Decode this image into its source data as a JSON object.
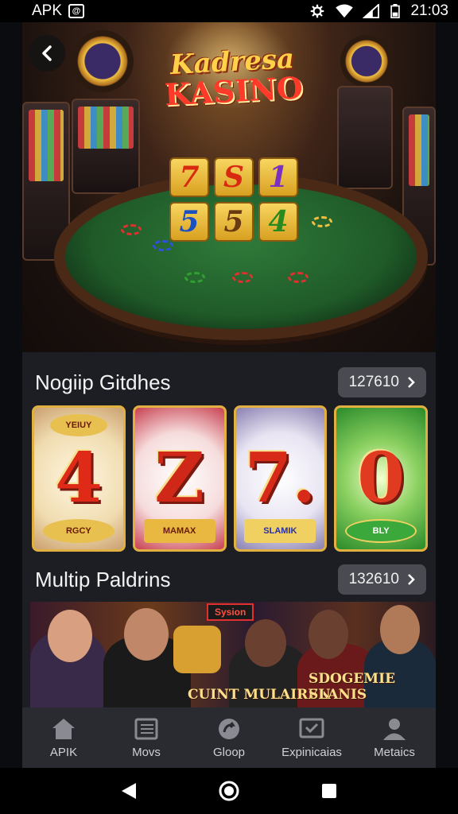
{
  "status_bar": {
    "app_label": "APK",
    "badge_glyph": "@",
    "time": "21:03"
  },
  "hero": {
    "logo_line1": "Kadresa",
    "logo_line2": "KASINO",
    "dice": [
      "7",
      "S",
      "1",
      "5",
      "5",
      "4"
    ],
    "dice_colors": [
      "#d82a10",
      "#d82a10",
      "#7a30c0",
      "#1a50c0",
      "#6a3a10",
      "#2a8a20"
    ]
  },
  "section1": {
    "title": "Nogiip Gitdhes",
    "pill_label": "127610",
    "slots": [
      {
        "number": "4",
        "top_badge": "YEIUY",
        "bottom_badge": "RGCY",
        "bg": "#f4e6c8",
        "num_color": "#e02a18"
      },
      {
        "number": "Z",
        "top_badge": "",
        "bottom_badge": "MAMAX",
        "bg": "#f6dcdc",
        "num_color": "#d02818"
      },
      {
        "number": "7.",
        "top_badge": "",
        "bottom_badge": "SLAMIK",
        "bg": "#e8e4f2",
        "num_color": "#d82a18"
      },
      {
        "number": "0",
        "top_badge": "",
        "bottom_badge": "BLY",
        "bg": "#3aa83a",
        "num_color": "#e03a20"
      }
    ]
  },
  "section2": {
    "title": "Multip Paldrins",
    "pill_label": "132610",
    "banner_tag": "Sysion",
    "banner_text_left": "CUINT MULAIREN",
    "banner_text_right": "SDOGEMIE SLANIS"
  },
  "bottom_nav": [
    {
      "label": "APIK",
      "icon": "home-icon"
    },
    {
      "label": "Movs",
      "icon": "book-icon"
    },
    {
      "label": "Gloop",
      "icon": "refresh-icon"
    },
    {
      "label": "Expinicaias",
      "icon": "tv-check-icon"
    },
    {
      "label": "Metaics",
      "icon": "person-icon"
    }
  ],
  "colors": {
    "screen_bg": "#1d1e24",
    "pill_bg": "#4a4b52",
    "nav_bg": "#2a2b31",
    "slot_border": "#e0b040"
  }
}
